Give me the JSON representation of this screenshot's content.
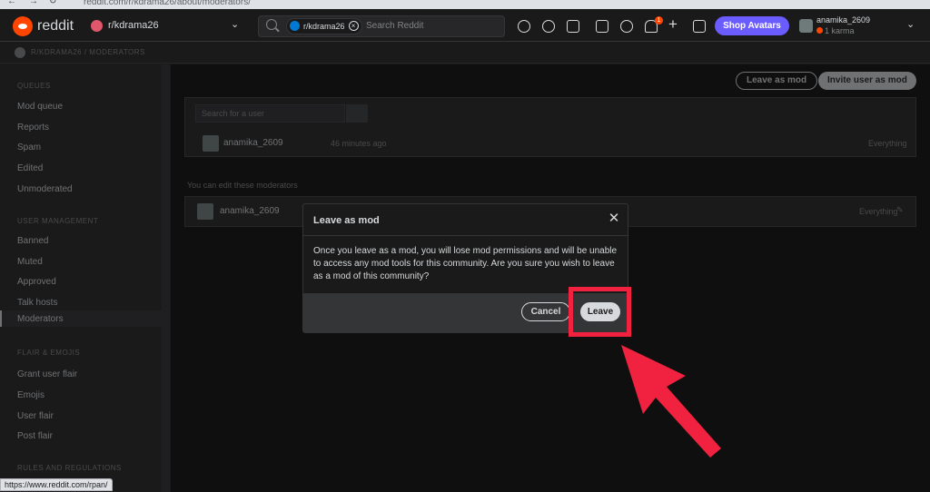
{
  "browser": {
    "url": "reddit.com/r/kdrama26/about/moderators/",
    "status_url": "https://www.reddit.com/rpan/"
  },
  "header": {
    "wordmark": "reddit",
    "subreddit": "r/kdrama26",
    "search_chip": "r/kdrama26",
    "search_placeholder": "Search Reddit",
    "notification_count": "1",
    "shop_label": "Shop Avatars",
    "username": "anamika_2609",
    "karma": "1 karma",
    "icons": [
      "popular-icon",
      "explore-icon",
      "coins-icon",
      "shield-icon",
      "chat-icon",
      "bell-icon",
      "plus-icon",
      "advertise-icon"
    ]
  },
  "breadcrumb": "R/KDRAMA26 / MODERATORS",
  "sidebar": {
    "queues_heading": "QUEUES",
    "queues": [
      "Mod queue",
      "Reports",
      "Spam",
      "Edited",
      "Unmoderated"
    ],
    "management_heading": "USER MANAGEMENT",
    "management": [
      "Banned",
      "Muted",
      "Approved",
      "Talk hosts",
      "Moderators"
    ],
    "flair_heading": "FLAIR & EMOJIS",
    "flair": [
      "Grant user flair",
      "Emojis",
      "User flair",
      "Post flair"
    ],
    "bottom_heading": "RULES AND REGULATIONS"
  },
  "main": {
    "leave_label": "Leave as mod",
    "invite_label": "Invite user as mod",
    "search_placeholder": "Search for a user",
    "mod_name": "anamika_2609",
    "mod_meta": "46 minutes ago",
    "mod_perms": "Everything",
    "editable_label": "You can edit these moderators",
    "edit_mod_name": "anamika_2609",
    "edit_mod_perms": "Everything"
  },
  "modal": {
    "title": "Leave as mod",
    "body": "Once you leave as a mod, you will lose mod permissions and will be unable to access any mod tools for this community. Are you sure you wish to leave as a mod of this community?",
    "cancel_label": "Cancel",
    "leave_label": "Leave"
  },
  "colors": {
    "accent_annotation": "#f0223f",
    "reddit_orange": "#ff4500",
    "shop_purple": "#6a5cff"
  }
}
